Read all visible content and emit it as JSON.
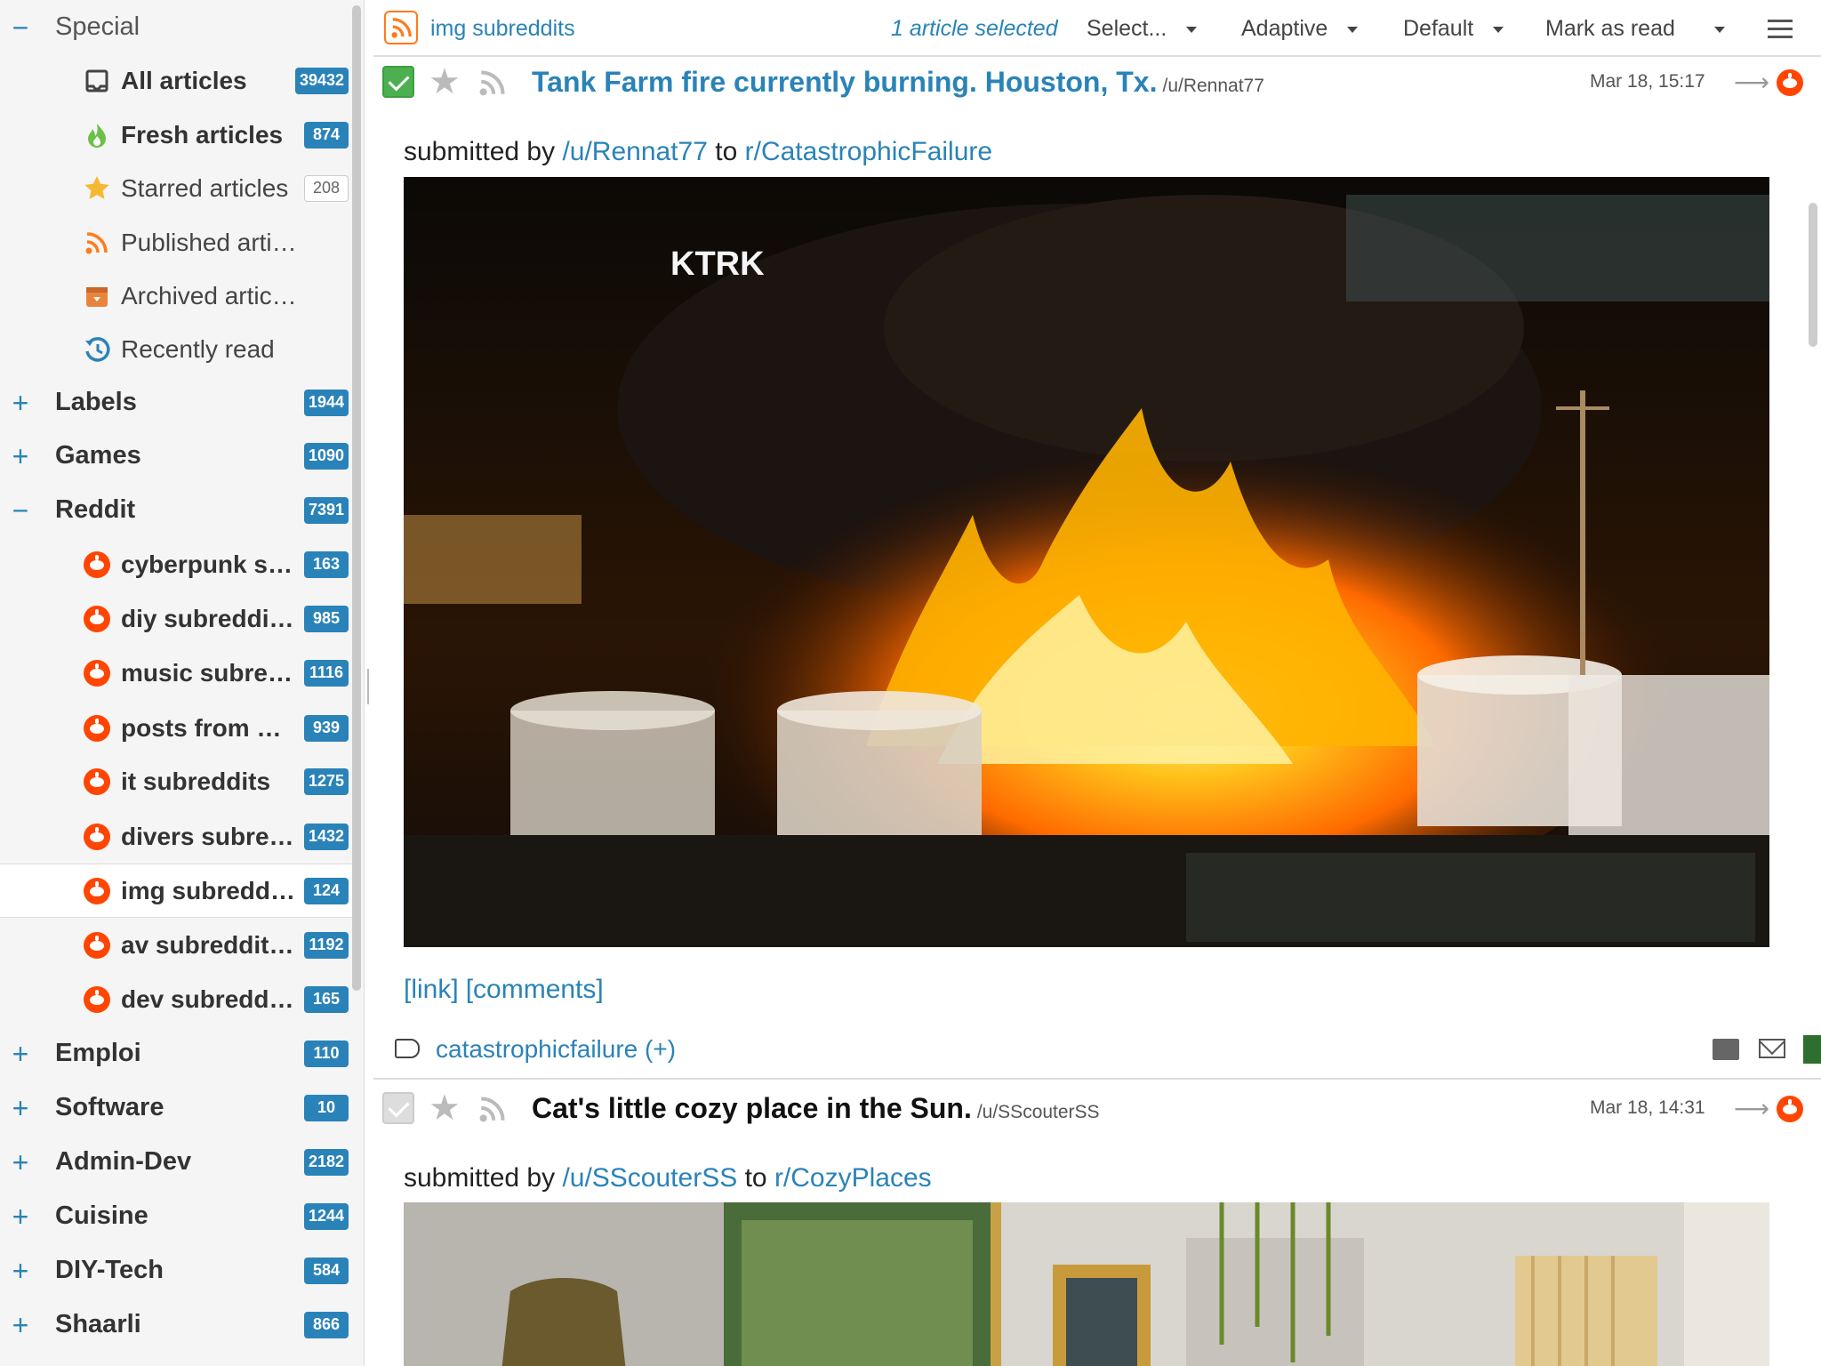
{
  "sidebar": {
    "special": {
      "toggle": "−",
      "label": "Special"
    },
    "special_items": [
      {
        "label": "All articles",
        "count": "39432",
        "icon": "inbox-icon"
      },
      {
        "label": "Fresh articles",
        "count": "874",
        "icon": "fresh-flame-icon"
      },
      {
        "label": "Starred articles",
        "count": "208",
        "icon": "star-icon"
      },
      {
        "label": "Published articles",
        "count": "",
        "icon": "rss-icon"
      },
      {
        "label": "Archived articles",
        "count": "",
        "icon": "archive-box-icon"
      },
      {
        "label": "Recently read",
        "count": "",
        "icon": "history-icon"
      }
    ],
    "categories_top": [
      {
        "toggle": "+",
        "label": "Labels",
        "count": "1944"
      },
      {
        "toggle": "+",
        "label": "Games",
        "count": "1090"
      },
      {
        "toggle": "−",
        "label": "Reddit",
        "count": "7391"
      }
    ],
    "reddit_feeds": [
      {
        "label": "cyberpunk s…",
        "count": "163"
      },
      {
        "label": "diy subreddi…",
        "count": "985"
      },
      {
        "label": "music subre…",
        "count": "1116"
      },
      {
        "label": "posts from w…",
        "count": "939"
      },
      {
        "label": "it subreddits",
        "count": "1275"
      },
      {
        "label": "divers subre…",
        "count": "1432"
      },
      {
        "label": "img subredd…",
        "count": "124"
      },
      {
        "label": "av subreddit…",
        "count": "1192"
      },
      {
        "label": "dev subredd…",
        "count": "165"
      }
    ],
    "categories_bottom": [
      {
        "toggle": "+",
        "label": "Emploi",
        "count": "110"
      },
      {
        "toggle": "+",
        "label": "Software",
        "count": "10"
      },
      {
        "toggle": "+",
        "label": "Admin-Dev",
        "count": "2182"
      },
      {
        "toggle": "+",
        "label": "Cuisine",
        "count": "1244"
      },
      {
        "toggle": "+",
        "label": "DIY-Tech",
        "count": "584"
      },
      {
        "toggle": "+",
        "label": "Shaarli",
        "count": "866"
      }
    ]
  },
  "header": {
    "feed_title": "img subreddits",
    "selection_status": "1 article selected",
    "select_menu": "Select...",
    "view_mode": "Adaptive",
    "sort_order": "Default",
    "mark_as_read": "Mark as read"
  },
  "articles": [
    {
      "title": "Tank Farm fire currently burning. Houston, Tx.",
      "author": "/u/Rennat77",
      "date": "Mar 18, 15:17",
      "submitted_prefix": "submitted by",
      "submitted_user": "/u/Rennat77",
      "submitted_to": "to",
      "subreddit": "r/CatastrophicFailure",
      "image_watermark": "KTRK",
      "link_label": "[link]",
      "comments_label": "[comments]",
      "tag": "catastrophicfailure",
      "tag_add": "(+)"
    },
    {
      "title": "Cat's little cozy place in the Sun.",
      "author": "/u/SScouterSS",
      "date": "Mar 18, 14:31",
      "submitted_prefix": "submitted by",
      "submitted_user": "/u/SScouterSS",
      "submitted_to": "to",
      "subreddit": "r/CozyPlaces"
    }
  ]
}
